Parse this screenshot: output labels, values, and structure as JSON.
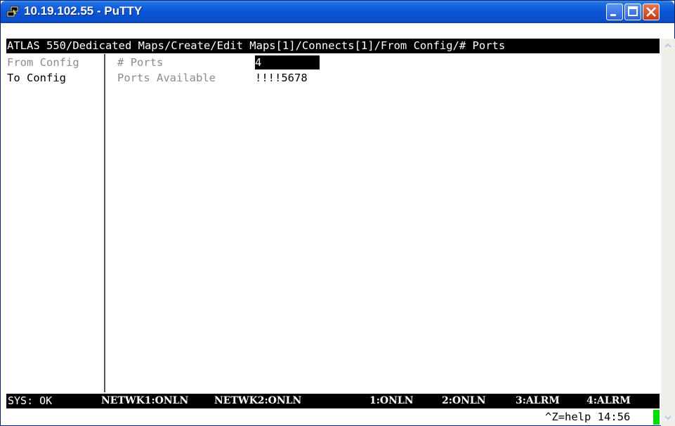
{
  "window": {
    "title": "10.19.102.55 - PuTTY",
    "icon": "putty-icon"
  },
  "terminal": {
    "path": "ATLAS 550/Dedicated Maps/Create/Edit Maps[1]/Connects[1]/From Config/# Ports",
    "menu": {
      "from_config": "From Config",
      "to_config": "To Config"
    },
    "fields": {
      "ports_label": "# Ports",
      "ports_value": "4",
      "available_label": "Ports Available",
      "available_value": "!!!!5678"
    },
    "status": {
      "sys": "SYS: OK",
      "netwk1": "NETWK1:ONLN",
      "netwk2": "NETWK2:ONLN",
      "p1": "1:ONLN",
      "p2": "2:ONLN",
      "p3": "3:ALRM",
      "p4": "4:ALRM"
    },
    "help": "^Z=help 14:56"
  },
  "colors": {
    "cursor": "#00e000",
    "text": "#000000",
    "dim_text": "#8c8c8c"
  }
}
